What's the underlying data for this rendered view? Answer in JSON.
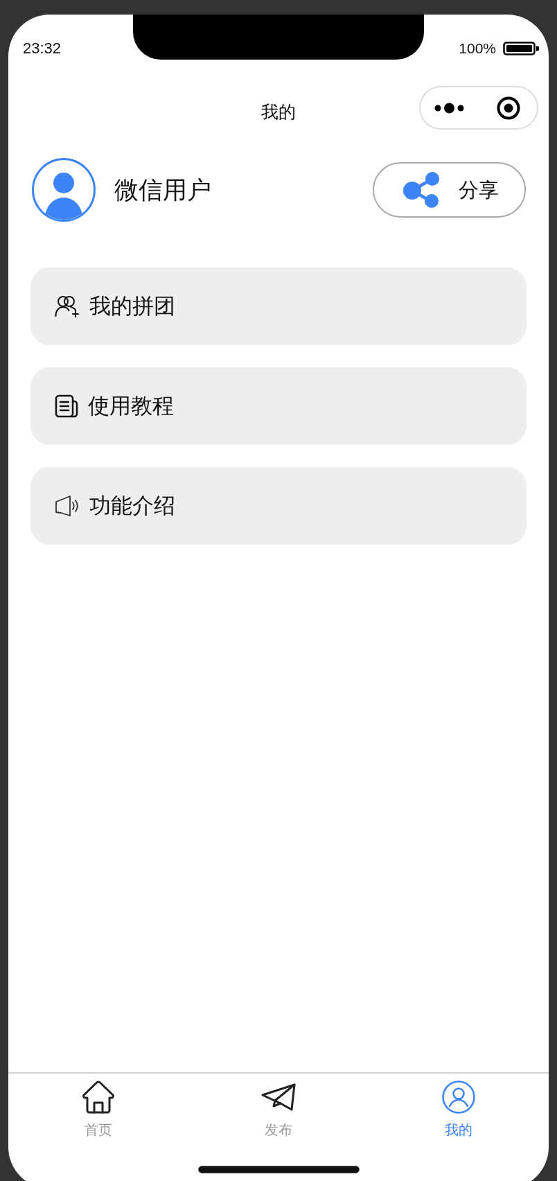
{
  "status_bar": {
    "time": "23:32",
    "battery": "100%"
  },
  "nav_bar": {
    "title": "我的"
  },
  "profile": {
    "name": "微信用户",
    "share_button": "分享"
  },
  "menu": [
    {
      "label": "我的拼团",
      "kind": "group"
    },
    {
      "label": "使用教程",
      "kind": "tutorial"
    },
    {
      "label": "功能介绍",
      "kind": "intro"
    }
  ],
  "tab_bar": [
    {
      "label": "首页",
      "kind": "home",
      "selected": false
    },
    {
      "label": "发布",
      "kind": "publish",
      "selected": false
    },
    {
      "label": "我的",
      "kind": "profile",
      "selected": true
    }
  ]
}
